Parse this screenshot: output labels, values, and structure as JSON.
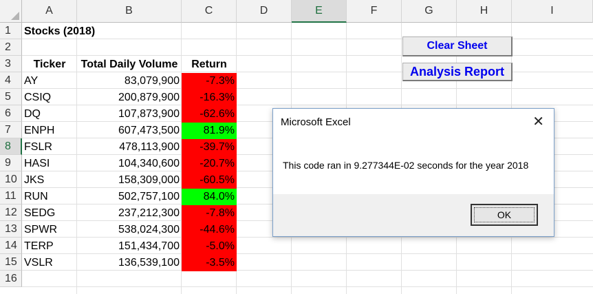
{
  "columns": [
    "A",
    "B",
    "C",
    "D",
    "E",
    "F",
    "G",
    "H",
    "I"
  ],
  "selected_column": "E",
  "rows": [
    "1",
    "2",
    "3",
    "4",
    "5",
    "6",
    "7",
    "8",
    "9",
    "10",
    "11",
    "12",
    "13",
    "14",
    "15",
    "16"
  ],
  "selected_row": "8",
  "title_cell": "Stocks (2018)",
  "headers": {
    "ticker": "Ticker",
    "volume": "Total Daily Volume",
    "return": "Return"
  },
  "stocks": [
    {
      "ticker": "AY",
      "volume": "83,079,900",
      "return": "-7.3%",
      "status": "negative"
    },
    {
      "ticker": "CSIQ",
      "volume": "200,879,900",
      "return": "-16.3%",
      "status": "negative"
    },
    {
      "ticker": "DQ",
      "volume": "107,873,900",
      "return": "-62.6%",
      "status": "negative"
    },
    {
      "ticker": "ENPH",
      "volume": "607,473,500",
      "return": "81.9%",
      "status": "positive"
    },
    {
      "ticker": "FSLR",
      "volume": "478,113,900",
      "return": "-39.7%",
      "status": "negative"
    },
    {
      "ticker": "HASI",
      "volume": "104,340,600",
      "return": "-20.7%",
      "status": "negative"
    },
    {
      "ticker": "JKS",
      "volume": "158,309,000",
      "return": "-60.5%",
      "status": "negative"
    },
    {
      "ticker": "RUN",
      "volume": "502,757,100",
      "return": "84.0%",
      "status": "positive"
    },
    {
      "ticker": "SEDG",
      "volume": "237,212,300",
      "return": "-7.8%",
      "status": "negative"
    },
    {
      "ticker": "SPWR",
      "volume": "538,024,300",
      "return": "-44.6%",
      "status": "negative"
    },
    {
      "ticker": "TERP",
      "volume": "151,434,700",
      "return": "-5.0%",
      "status": "negative"
    },
    {
      "ticker": "VSLR",
      "volume": "136,539,100",
      "return": "-3.5%",
      "status": "negative"
    }
  ],
  "buttons": {
    "clear_sheet": "Clear Sheet",
    "analysis_report": "Analysis Report"
  },
  "dialog": {
    "title": "Microsoft Excel",
    "message": "This code ran in 9.277344E-02 seconds for the year 2018",
    "ok_label": "OK",
    "close_glyph": "✕"
  },
  "colors": {
    "negative": "#ff0000",
    "positive": "#00ff00",
    "button_text": "#0000ee",
    "excel_green": "#217346"
  }
}
